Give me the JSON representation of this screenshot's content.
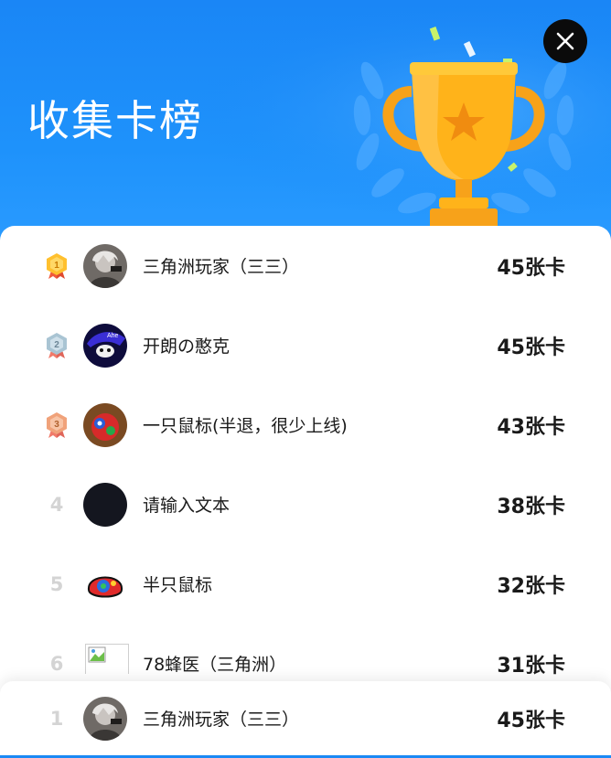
{
  "header": {
    "title": "收集卡榜",
    "close_icon": "close-icon",
    "trophy_icon": "trophy-icon",
    "colors": {
      "background": "#1a86f6",
      "trophy": "#ffb31a"
    }
  },
  "leaderboard": {
    "rows": [
      {
        "rank": "1",
        "rank_badge": "gold-medal-icon",
        "name": "三角洲玩家（三三）",
        "score": "45张卡"
      },
      {
        "rank": "2",
        "rank_badge": "silver-medal-icon",
        "name": "开朗の憨克",
        "score": "45张卡"
      },
      {
        "rank": "3",
        "rank_badge": "bronze-medal-icon",
        "name": "一只鼠标(半退，很少上线)",
        "score": "43张卡"
      },
      {
        "rank": "4",
        "rank_badge": "",
        "name": "请输入文本",
        "score": "38张卡"
      },
      {
        "rank": "5",
        "rank_badge": "",
        "name": "半只鼠标",
        "score": "32张卡"
      },
      {
        "rank": "6",
        "rank_badge": "",
        "name": "78蜂医（三角洲）",
        "score": "31张卡"
      }
    ]
  },
  "my_rank": {
    "rank": "1",
    "name": "三角洲玩家（三三）",
    "score": "45张卡"
  }
}
